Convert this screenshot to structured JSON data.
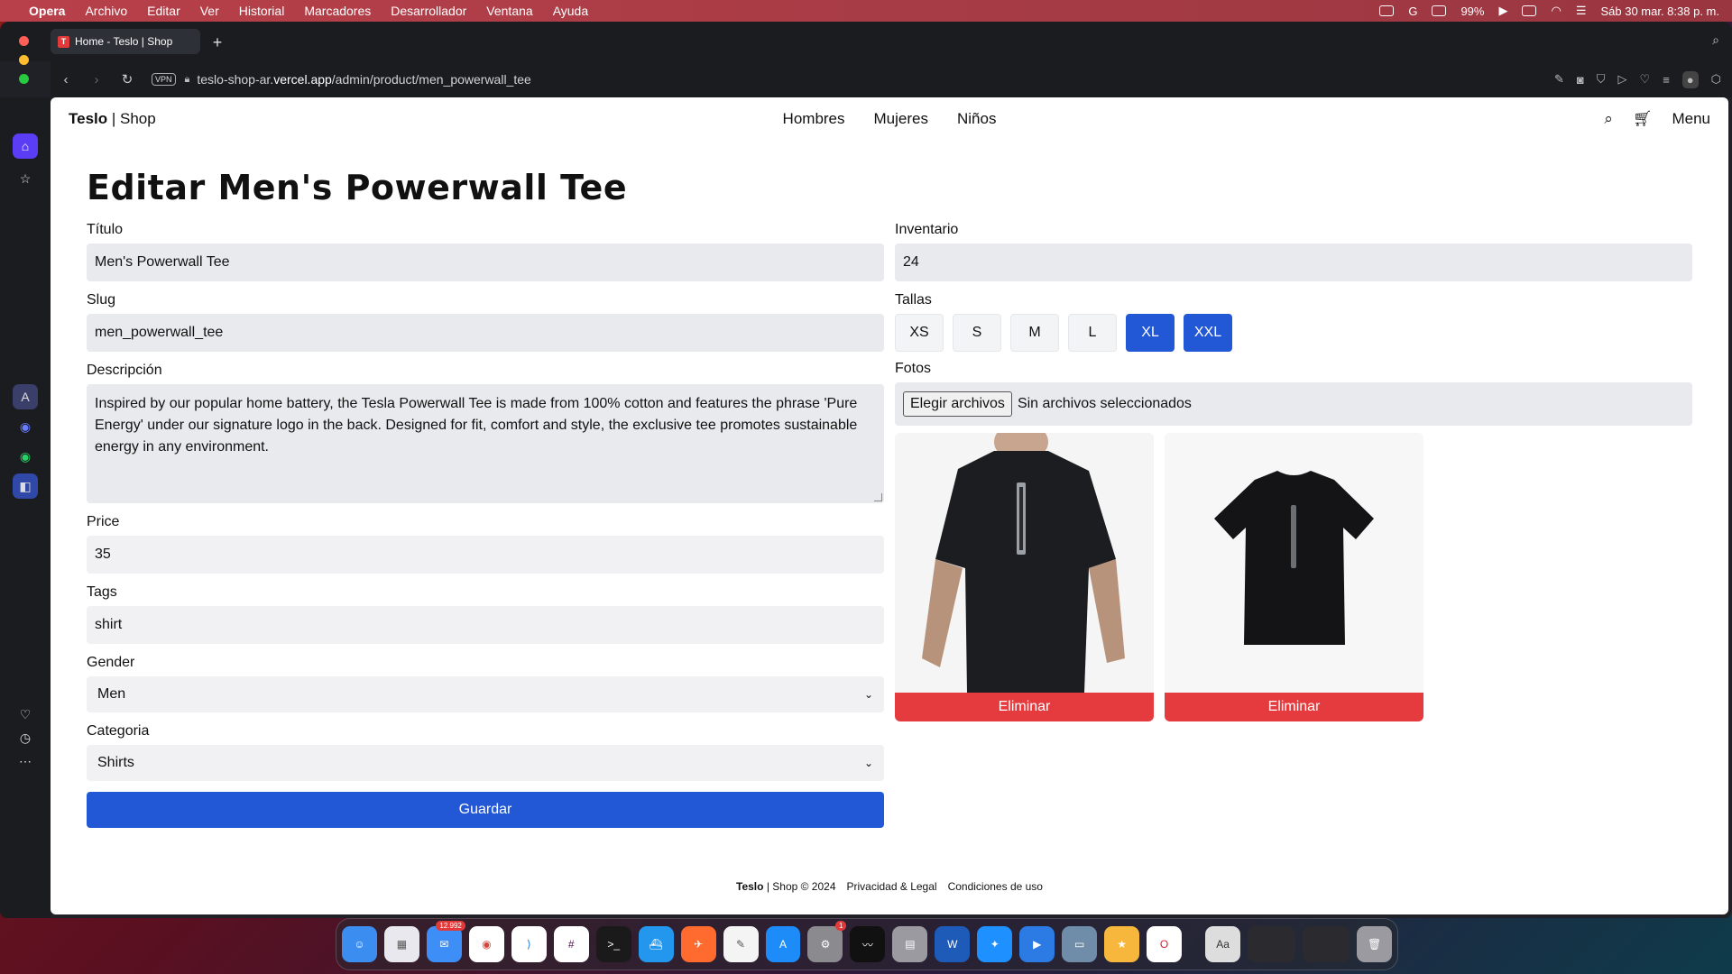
{
  "menubar": {
    "app": "Opera",
    "items": [
      "Archivo",
      "Editar",
      "Ver",
      "Historial",
      "Marcadores",
      "Desarrollador",
      "Ventana",
      "Ayuda"
    ],
    "battery": "99%",
    "datetime": "Sáb 30 mar.  8:38 p. m."
  },
  "browser": {
    "tab_title": "Home - Teslo | Shop",
    "tab_favicon": "T",
    "url_host_prefix": "teslo-shop-ar.",
    "url_host_main": "vercel.app",
    "url_path": "/admin/product/men_powerwall_tee",
    "vpn_label": "VPN"
  },
  "site": {
    "logo_brand": "Teslo",
    "logo_rest": "| Shop",
    "nav": [
      "Hombres",
      "Mujeres",
      "Niños"
    ],
    "menu_label": "Menu"
  },
  "form": {
    "page_title": "Editar Men's Powerwall Tee",
    "title_label": "Título",
    "title_value": "Men's Powerwall Tee",
    "slug_label": "Slug",
    "slug_value": "men_powerwall_tee",
    "description_label": "Descripción",
    "description_value": "Inspired by our popular home battery, the Tesla Powerwall Tee is made from 100% cotton and features the phrase 'Pure Energy' under our signature logo in the back. Designed for fit, comfort and style, the exclusive tee promotes sustainable energy in any environment.",
    "price_label": "Price",
    "price_value": "35",
    "tags_label": "Tags",
    "tags_value": "shirt",
    "gender_label": "Gender",
    "gender_value": "Men",
    "category_label": "Categoria",
    "category_value": "Shirts",
    "save_label": "Guardar",
    "inventory_label": "Inventario",
    "inventory_value": "24",
    "sizes_label": "Tallas",
    "sizes": [
      {
        "label": "XS",
        "selected": false
      },
      {
        "label": "S",
        "selected": false
      },
      {
        "label": "M",
        "selected": false
      },
      {
        "label": "L",
        "selected": false
      },
      {
        "label": "XL",
        "selected": true
      },
      {
        "label": "XXL",
        "selected": true
      }
    ],
    "photos_label": "Fotos",
    "file_button": "Elegir archivos",
    "file_status": "Sin archivos seleccionados",
    "delete_label": "Eliminar"
  },
  "footer": {
    "brand": "Teslo",
    "copyright": "| Shop © 2024",
    "privacy": "Privacidad & Legal",
    "terms": "Condiciones de uso"
  },
  "dock": {
    "mail_badge": "12.992",
    "settings_badge": "1"
  },
  "colors": {
    "primary": "#2257d6",
    "danger": "#e53a3e",
    "input_bg": "#e9eaed"
  }
}
